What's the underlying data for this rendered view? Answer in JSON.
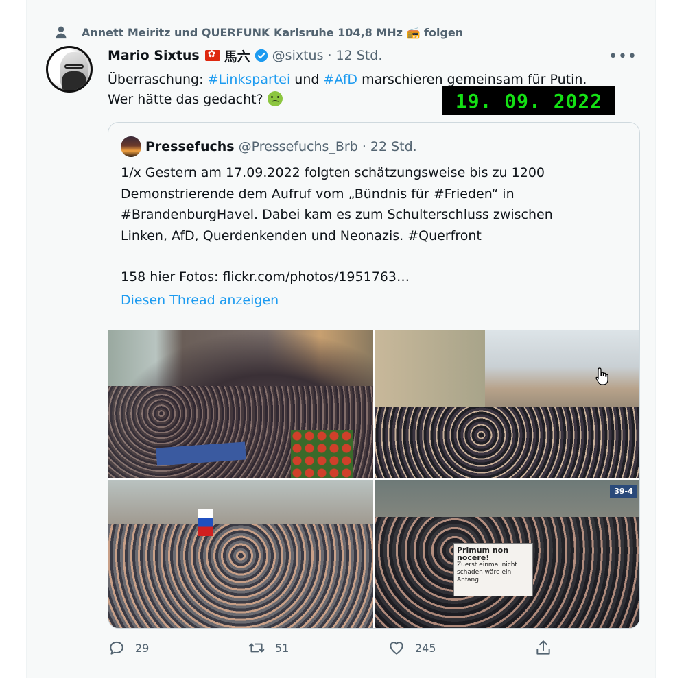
{
  "social_context": {
    "text": "Annett Meiritz und QUERFUNK Karlsruhe 104,8 MHz 📻 folgen",
    "icon": "person-icon"
  },
  "tweet": {
    "author_name": "Mario Sixtus",
    "author_suffix": "馬六",
    "handle": "@sixtus",
    "separator": "·",
    "time": "12 Std.",
    "text_part1": "Überraschung: ",
    "hashtag1": "#Linkspartei",
    "text_part2": " und ",
    "hashtag2": "#AfD",
    "text_part3": " marschieren gemeinsam für Putin.",
    "text_line2": "Wer hätte das gedacht? ",
    "more_label": "•••"
  },
  "date_stamp": "19. 09. 2022",
  "quote": {
    "author_name": "Pressefuchs",
    "handle": "@Pressefuchs_Brb",
    "separator": "·",
    "time": "22 Std.",
    "lines": [
      "1/x Gestern am 17.09.2022 folgten schätzungsweise bis zu 1200",
      "Demonstrierende dem Aufruf vom „Bündnis für #Frieden“ in",
      "#BrandenburgHavel. Dabei kam es zum Schulterschluss zwischen",
      "Linken, AfD, Querdenkenden und Neonazis. #Querfront",
      "158 hier Fotos: flickr.com/photos/1951763…"
    ],
    "thread_link": "Diesen Thread anzeigen"
  },
  "photo_texts": {
    "sign_title": "Primum non nocere!",
    "sign_line": "Zuerst einmal nicht schaden wäre ein Anfang",
    "plate": "39-4"
  },
  "actions": {
    "reply_count": "29",
    "retweet_count": "51",
    "like_count": "245"
  },
  "colors": {
    "accent": "#1d9bf0",
    "secondary_text": "#536471",
    "background": "#f7f9f9",
    "date_stamp_text": "#14e014"
  }
}
